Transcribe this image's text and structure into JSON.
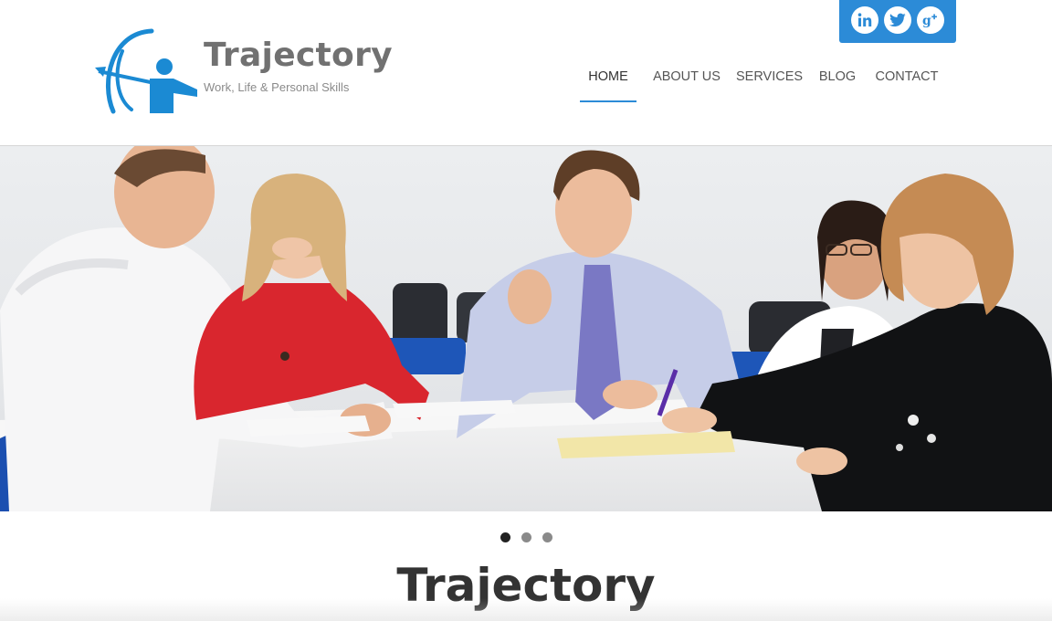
{
  "brand": {
    "title": "Trajectory",
    "tagline": "Work, Life & Personal Skills",
    "logo_icon": "archer-logo-icon",
    "accent_color": "#2c8bd7"
  },
  "social": [
    {
      "name": "LinkedIn",
      "icon": "linkedin-icon"
    },
    {
      "name": "Twitter",
      "icon": "twitter-icon"
    },
    {
      "name": "Google+",
      "icon": "google-plus-icon"
    }
  ],
  "nav": {
    "items": [
      {
        "label": "HOME",
        "active": true
      },
      {
        "label": "ABOUT US",
        "active": false
      },
      {
        "label": "SERVICES",
        "active": false
      },
      {
        "label": "BLOG",
        "active": false
      },
      {
        "label": "CONTACT",
        "active": false
      }
    ]
  },
  "slider": {
    "slide_count": 3,
    "active_slide": 1
  },
  "main": {
    "heading": "Trajectory"
  }
}
